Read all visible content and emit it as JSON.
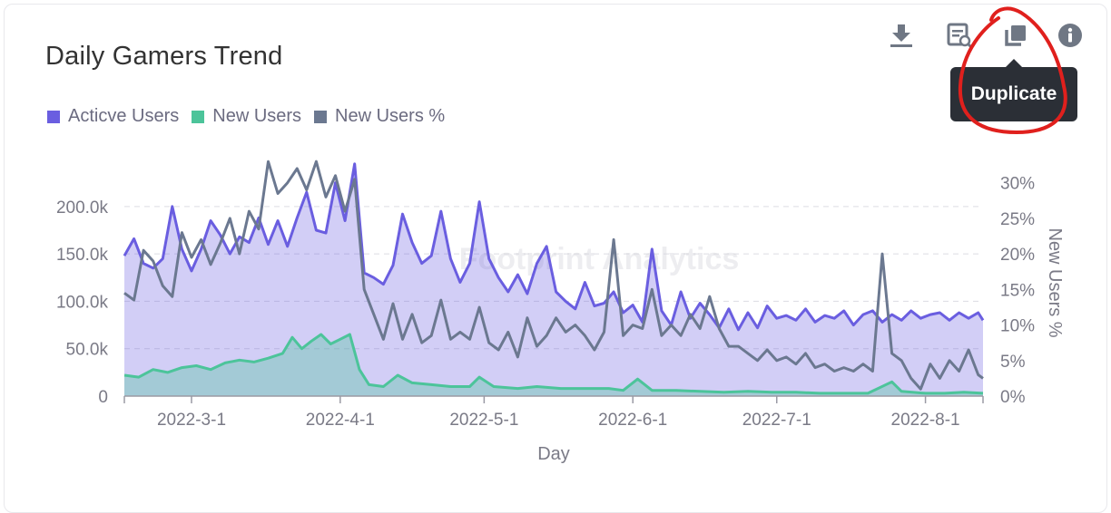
{
  "card": {
    "title": "Daily Gamers Trend",
    "legend": [
      {
        "name": "Acticve Users",
        "color": "#6a5ee0"
      },
      {
        "name": "New Users",
        "color": "#4cc49a"
      },
      {
        "name": "New Users %",
        "color": "#6b7890"
      }
    ],
    "toolbar": {
      "icons": [
        "download-icon",
        "view-query-icon",
        "duplicate-icon",
        "info-icon"
      ],
      "tooltip": "Duplicate"
    },
    "watermark": "Footprint Analytics",
    "annotation_color": "#e0201d"
  },
  "chart_data": {
    "type": "line",
    "title": "Daily Gamers Trend",
    "xlabel": "Day",
    "ylabel": "",
    "y2label": "New Users %",
    "x_ticks": [
      "2022-3-1",
      "2022-4-1",
      "2022-5-1",
      "2022-6-1",
      "2022-7-1",
      "2022-8-1"
    ],
    "y_ticks": [
      "0",
      "50.0k",
      "100.0k",
      "150.0k",
      "200.0k"
    ],
    "y2_ticks": [
      "0%",
      "5%",
      "10%",
      "15%",
      "20%",
      "25%",
      "30%"
    ],
    "ylim": [
      0,
      240000
    ],
    "y2lim": [
      0,
      32
    ],
    "x_range": [
      "2022-02-15",
      "2022-08-13"
    ],
    "legend_position": "top-left",
    "grid": true,
    "series": [
      {
        "name": "Acticve Users",
        "axis": "left",
        "style": "area-line",
        "color": "#6a5ee0",
        "points": [
          [
            "2022-02-15",
            148000
          ],
          [
            "2022-02-17",
            166000
          ],
          [
            "2022-02-19",
            140000
          ],
          [
            "2022-02-21",
            135000
          ],
          [
            "2022-02-23",
            145000
          ],
          [
            "2022-02-25",
            200000
          ],
          [
            "2022-02-27",
            155000
          ],
          [
            "2022-03-01",
            132000
          ],
          [
            "2022-03-03",
            155000
          ],
          [
            "2022-03-05",
            185000
          ],
          [
            "2022-03-07",
            170000
          ],
          [
            "2022-03-09",
            150000
          ],
          [
            "2022-03-11",
            168000
          ],
          [
            "2022-03-13",
            162000
          ],
          [
            "2022-03-15",
            188000
          ],
          [
            "2022-03-17",
            160000
          ],
          [
            "2022-03-19",
            185000
          ],
          [
            "2022-03-21",
            158000
          ],
          [
            "2022-03-23",
            188000
          ],
          [
            "2022-03-25",
            215000
          ],
          [
            "2022-03-27",
            175000
          ],
          [
            "2022-03-29",
            172000
          ],
          [
            "2022-03-31",
            225000
          ],
          [
            "2022-04-02",
            185000
          ],
          [
            "2022-04-04",
            245000
          ],
          [
            "2022-04-06",
            130000
          ],
          [
            "2022-04-08",
            125000
          ],
          [
            "2022-04-10",
            118000
          ],
          [
            "2022-04-12",
            138000
          ],
          [
            "2022-04-14",
            192000
          ],
          [
            "2022-04-16",
            162000
          ],
          [
            "2022-04-18",
            140000
          ],
          [
            "2022-04-20",
            148000
          ],
          [
            "2022-04-22",
            195000
          ],
          [
            "2022-04-24",
            145000
          ],
          [
            "2022-04-26",
            120000
          ],
          [
            "2022-04-28",
            140000
          ],
          [
            "2022-04-30",
            205000
          ],
          [
            "2022-05-02",
            145000
          ],
          [
            "2022-05-04",
            125000
          ],
          [
            "2022-05-06",
            110000
          ],
          [
            "2022-05-08",
            128000
          ],
          [
            "2022-05-10",
            108000
          ],
          [
            "2022-05-12",
            140000
          ],
          [
            "2022-05-14",
            158000
          ],
          [
            "2022-05-16",
            110000
          ],
          [
            "2022-05-18",
            100000
          ],
          [
            "2022-05-20",
            92000
          ],
          [
            "2022-05-22",
            120000
          ],
          [
            "2022-05-24",
            95000
          ],
          [
            "2022-05-26",
            98000
          ],
          [
            "2022-05-28",
            110000
          ],
          [
            "2022-05-30",
            88000
          ],
          [
            "2022-06-01",
            96000
          ],
          [
            "2022-06-03",
            78000
          ],
          [
            "2022-06-05",
            155000
          ],
          [
            "2022-06-07",
            90000
          ],
          [
            "2022-06-09",
            75000
          ],
          [
            "2022-06-11",
            110000
          ],
          [
            "2022-06-13",
            82000
          ],
          [
            "2022-06-15",
            98000
          ],
          [
            "2022-06-17",
            86000
          ],
          [
            "2022-06-19",
            72000
          ],
          [
            "2022-06-21",
            92000
          ],
          [
            "2022-06-23",
            70000
          ],
          [
            "2022-06-25",
            88000
          ],
          [
            "2022-06-27",
            72000
          ],
          [
            "2022-06-29",
            95000
          ],
          [
            "2022-07-01",
            82000
          ],
          [
            "2022-07-03",
            85000
          ],
          [
            "2022-07-05",
            80000
          ],
          [
            "2022-07-07",
            92000
          ],
          [
            "2022-07-09",
            78000
          ],
          [
            "2022-07-11",
            85000
          ],
          [
            "2022-07-13",
            82000
          ],
          [
            "2022-07-15",
            90000
          ],
          [
            "2022-07-17",
            75000
          ],
          [
            "2022-07-19",
            86000
          ],
          [
            "2022-07-21",
            90000
          ],
          [
            "2022-07-23",
            78000
          ],
          [
            "2022-07-25",
            86000
          ],
          [
            "2022-07-27",
            80000
          ],
          [
            "2022-07-29",
            90000
          ],
          [
            "2022-07-31",
            82000
          ],
          [
            "2022-08-02",
            86000
          ],
          [
            "2022-08-04",
            88000
          ],
          [
            "2022-08-06",
            80000
          ],
          [
            "2022-08-08",
            88000
          ],
          [
            "2022-08-10",
            82000
          ],
          [
            "2022-08-12",
            88000
          ],
          [
            "2022-08-13",
            80000
          ]
        ]
      },
      {
        "name": "New Users",
        "axis": "left",
        "style": "area-line",
        "color": "#4cc49a",
        "points": [
          [
            "2022-02-15",
            22000
          ],
          [
            "2022-02-18",
            20000
          ],
          [
            "2022-02-21",
            28000
          ],
          [
            "2022-02-24",
            25000
          ],
          [
            "2022-02-27",
            30000
          ],
          [
            "2022-03-02",
            32000
          ],
          [
            "2022-03-05",
            28000
          ],
          [
            "2022-03-08",
            35000
          ],
          [
            "2022-03-11",
            38000
          ],
          [
            "2022-03-14",
            36000
          ],
          [
            "2022-03-17",
            40000
          ],
          [
            "2022-03-20",
            45000
          ],
          [
            "2022-03-22",
            62000
          ],
          [
            "2022-03-24",
            50000
          ],
          [
            "2022-03-26",
            58000
          ],
          [
            "2022-03-28",
            65000
          ],
          [
            "2022-03-30",
            55000
          ],
          [
            "2022-04-01",
            60000
          ],
          [
            "2022-04-03",
            65000
          ],
          [
            "2022-04-05",
            28000
          ],
          [
            "2022-04-07",
            12000
          ],
          [
            "2022-04-10",
            10000
          ],
          [
            "2022-04-13",
            22000
          ],
          [
            "2022-04-16",
            14000
          ],
          [
            "2022-04-20",
            12000
          ],
          [
            "2022-04-24",
            10000
          ],
          [
            "2022-04-28",
            10000
          ],
          [
            "2022-04-30",
            20000
          ],
          [
            "2022-05-03",
            10000
          ],
          [
            "2022-05-08",
            8000
          ],
          [
            "2022-05-12",
            10000
          ],
          [
            "2022-05-17",
            8000
          ],
          [
            "2022-05-22",
            8000
          ],
          [
            "2022-05-27",
            8000
          ],
          [
            "2022-05-30",
            6000
          ],
          [
            "2022-06-02",
            18000
          ],
          [
            "2022-06-05",
            6000
          ],
          [
            "2022-06-10",
            6000
          ],
          [
            "2022-06-15",
            5000
          ],
          [
            "2022-06-20",
            4000
          ],
          [
            "2022-06-25",
            5000
          ],
          [
            "2022-06-30",
            4000
          ],
          [
            "2022-07-05",
            4000
          ],
          [
            "2022-07-10",
            3000
          ],
          [
            "2022-07-15",
            3000
          ],
          [
            "2022-07-20",
            3000
          ],
          [
            "2022-07-25",
            15000
          ],
          [
            "2022-07-27",
            5000
          ],
          [
            "2022-08-01",
            3000
          ],
          [
            "2022-08-05",
            3000
          ],
          [
            "2022-08-09",
            4000
          ],
          [
            "2022-08-13",
            3000
          ]
        ]
      },
      {
        "name": "New Users %",
        "axis": "right",
        "style": "line",
        "color": "#6b7890",
        "points": [
          [
            "2022-02-15",
            14.5
          ],
          [
            "2022-02-17",
            13.5
          ],
          [
            "2022-02-19",
            20.5
          ],
          [
            "2022-02-21",
            19.0
          ],
          [
            "2022-02-23",
            15.5
          ],
          [
            "2022-02-25",
            14.0
          ],
          [
            "2022-02-27",
            23.0
          ],
          [
            "2022-03-01",
            19.5
          ],
          [
            "2022-03-03",
            22.0
          ],
          [
            "2022-03-05",
            18.5
          ],
          [
            "2022-03-07",
            21.5
          ],
          [
            "2022-03-09",
            25.0
          ],
          [
            "2022-03-11",
            20.0
          ],
          [
            "2022-03-13",
            26.0
          ],
          [
            "2022-03-15",
            23.5
          ],
          [
            "2022-03-17",
            33.0
          ],
          [
            "2022-03-19",
            28.5
          ],
          [
            "2022-03-21",
            30.0
          ],
          [
            "2022-03-23",
            32.0
          ],
          [
            "2022-03-25",
            29.0
          ],
          [
            "2022-03-27",
            33.0
          ],
          [
            "2022-03-29",
            28.0
          ],
          [
            "2022-03-31",
            31.0
          ],
          [
            "2022-04-02",
            26.0
          ],
          [
            "2022-04-04",
            30.5
          ],
          [
            "2022-04-06",
            15.0
          ],
          [
            "2022-04-08",
            11.5
          ],
          [
            "2022-04-10",
            8.0
          ],
          [
            "2022-04-12",
            13.0
          ],
          [
            "2022-04-14",
            8.0
          ],
          [
            "2022-04-16",
            11.5
          ],
          [
            "2022-04-18",
            7.5
          ],
          [
            "2022-04-20",
            8.5
          ],
          [
            "2022-04-22",
            13.5
          ],
          [
            "2022-04-24",
            8.0
          ],
          [
            "2022-04-26",
            9.0
          ],
          [
            "2022-04-28",
            8.0
          ],
          [
            "2022-04-30",
            12.5
          ],
          [
            "2022-05-02",
            7.5
          ],
          [
            "2022-05-04",
            6.5
          ],
          [
            "2022-05-06",
            9.0
          ],
          [
            "2022-05-08",
            5.5
          ],
          [
            "2022-05-10",
            11.0
          ],
          [
            "2022-05-12",
            7.0
          ],
          [
            "2022-05-14",
            8.5
          ],
          [
            "2022-05-16",
            11.0
          ],
          [
            "2022-05-18",
            9.0
          ],
          [
            "2022-05-20",
            10.0
          ],
          [
            "2022-05-22",
            8.5
          ],
          [
            "2022-05-24",
            6.5
          ],
          [
            "2022-05-26",
            9.0
          ],
          [
            "2022-05-28",
            22.0
          ],
          [
            "2022-05-30",
            8.5
          ],
          [
            "2022-06-01",
            10.0
          ],
          [
            "2022-06-03",
            9.5
          ],
          [
            "2022-06-05",
            15.0
          ],
          [
            "2022-06-07",
            8.5
          ],
          [
            "2022-06-09",
            10.0
          ],
          [
            "2022-06-11",
            8.5
          ],
          [
            "2022-06-13",
            11.5
          ],
          [
            "2022-06-15",
            9.5
          ],
          [
            "2022-06-17",
            14.0
          ],
          [
            "2022-06-19",
            9.5
          ],
          [
            "2022-06-21",
            7.0
          ],
          [
            "2022-06-23",
            7.0
          ],
          [
            "2022-06-25",
            6.0
          ],
          [
            "2022-06-27",
            5.0
          ],
          [
            "2022-06-29",
            6.5
          ],
          [
            "2022-07-01",
            5.0
          ],
          [
            "2022-07-03",
            5.5
          ],
          [
            "2022-07-05",
            4.5
          ],
          [
            "2022-07-07",
            6.0
          ],
          [
            "2022-07-09",
            4.0
          ],
          [
            "2022-07-11",
            4.5
          ],
          [
            "2022-07-13",
            3.5
          ],
          [
            "2022-07-15",
            4.0
          ],
          [
            "2022-07-17",
            3.5
          ],
          [
            "2022-07-19",
            4.5
          ],
          [
            "2022-07-21",
            3.5
          ],
          [
            "2022-07-23",
            20.0
          ],
          [
            "2022-07-25",
            6.0
          ],
          [
            "2022-07-27",
            5.0
          ],
          [
            "2022-07-29",
            2.5
          ],
          [
            "2022-07-31",
            1.0
          ],
          [
            "2022-08-02",
            4.5
          ],
          [
            "2022-08-04",
            2.5
          ],
          [
            "2022-08-06",
            5.0
          ],
          [
            "2022-08-08",
            3.5
          ],
          [
            "2022-08-10",
            6.5
          ],
          [
            "2022-08-12",
            3.0
          ],
          [
            "2022-08-13",
            2.5
          ]
        ]
      }
    ]
  }
}
